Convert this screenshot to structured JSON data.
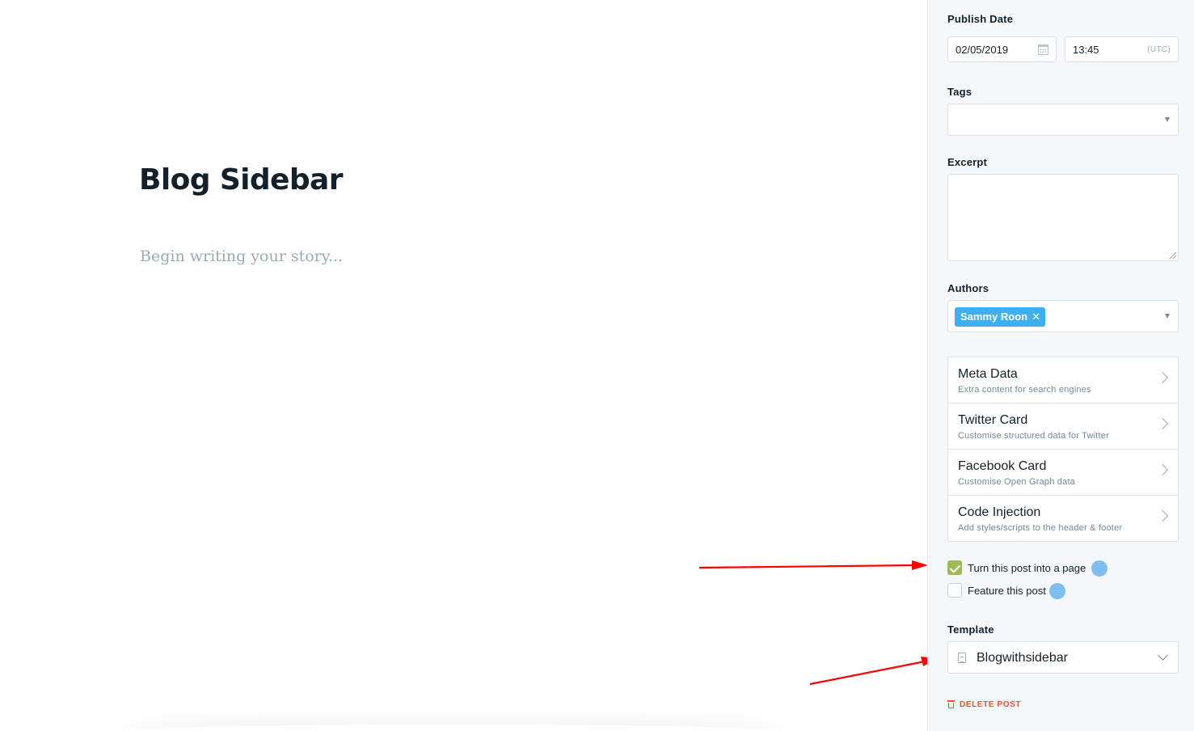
{
  "editor": {
    "title": "Blog Sidebar",
    "body_placeholder": "Begin writing your story..."
  },
  "settings": {
    "publish_date": {
      "label": "Publish Date",
      "date_value": "02/05/2019",
      "time_value": "13:45",
      "timezone": "(UTC)"
    },
    "tags": {
      "label": "Tags",
      "value": ""
    },
    "excerpt": {
      "label": "Excerpt",
      "value": ""
    },
    "authors": {
      "label": "Authors",
      "selected": [
        "Sammy Roon"
      ]
    },
    "nav_items": [
      {
        "title": "Meta Data",
        "description": "Extra content for search engines"
      },
      {
        "title": "Twitter Card",
        "description": "Customise structured data for Twitter"
      },
      {
        "title": "Facebook Card",
        "description": "Customise Open Graph data"
      },
      {
        "title": "Code Injection",
        "description": "Add styles/scripts to the header & footer"
      }
    ],
    "toggles": [
      {
        "label": "Turn this post into a page",
        "checked": true
      },
      {
        "label": "Feature this post",
        "checked": false
      }
    ],
    "template": {
      "label": "Template",
      "value": "Blogwithsidebar"
    },
    "delete_label": "DELETE POST"
  },
  "colors": {
    "sidebar_bg": "#f4f8fb",
    "chip_blue": "#3eb0ef",
    "checkbox_green": "#9fbb58",
    "delete_red": "#f05230",
    "annotation_red": "#ff0000",
    "click_indicator": "#52a8ec"
  },
  "icons": {
    "date": "calendar-icon",
    "dropdown": "caret-down-icon",
    "nav": "chevron-right-icon",
    "template": "document-icon",
    "delete": "trash-icon",
    "chip_remove": "close-icon"
  }
}
